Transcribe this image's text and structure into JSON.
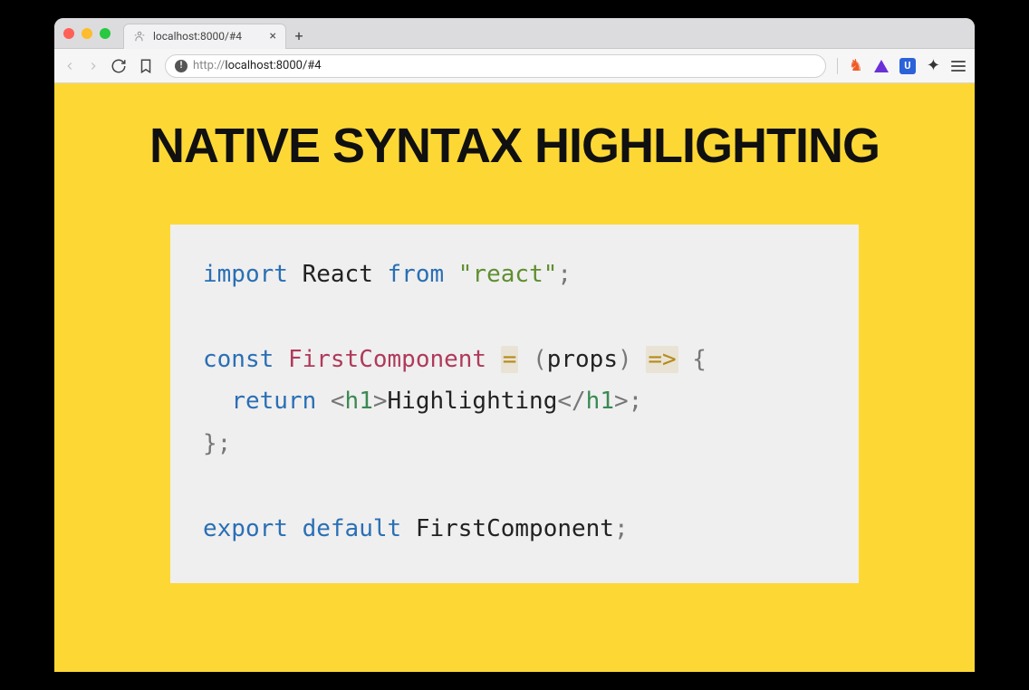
{
  "browser": {
    "tab_title": "localhost:8000/#4",
    "url_prefix": "http://",
    "url_main": "localhost:8000/#4",
    "close_glyph": "×",
    "newtab_glyph": "+",
    "info_glyph": "!",
    "brave_glyph": "♞",
    "shield_glyph": "U",
    "puzzle_glyph": "✦"
  },
  "page": {
    "headline": "NATIVE SYNTAX HIGHLIGHTING"
  },
  "code": {
    "tokens": {
      "import": "import",
      "react_cls": "React",
      "from": "from",
      "react_str": "\"react\"",
      "semicolon": ";",
      "const": "const",
      "fn_name": "FirstComponent",
      "assign": "=",
      "lparen": "(",
      "param": "props",
      "rparen": ")",
      "arrow": "=>",
      "lbrace": "{",
      "return": "return",
      "tag_open_l": "<",
      "tag_name": "h1",
      "tag_open_r": ">",
      "content": "Highlighting",
      "tag_close_l": "</",
      "tag_close_r": ">",
      "rbrace": "}",
      "export": "export",
      "default": "default",
      "export_name": "FirstComponent"
    }
  }
}
